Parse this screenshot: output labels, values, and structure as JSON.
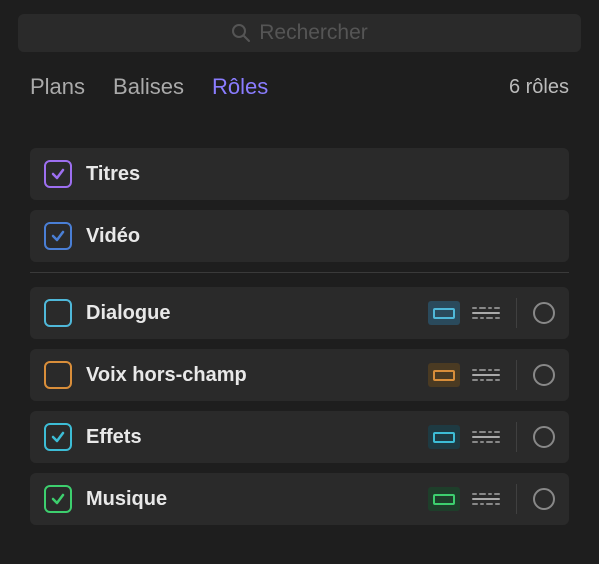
{
  "search": {
    "placeholder": "Rechercher"
  },
  "tabs": {
    "plans": "Plans",
    "balises": "Balises",
    "roles": "Rôles"
  },
  "count": "6 rôles",
  "colors": {
    "purple": "#9d6ff0",
    "blue": "#4a7fd6",
    "lightblue": "#4fb8d9",
    "orange": "#d98e3a",
    "cyan": "#3dbdd6",
    "green": "#3dcf6e"
  },
  "roles": {
    "titres": {
      "label": "Titres",
      "checked": true
    },
    "video": {
      "label": "Vidéo",
      "checked": true
    },
    "dialogue": {
      "label": "Dialogue",
      "checked": false
    },
    "voix": {
      "label": "Voix hors-champ",
      "checked": false
    },
    "effets": {
      "label": "Effets",
      "checked": true
    },
    "musique": {
      "label": "Musique",
      "checked": true
    }
  }
}
